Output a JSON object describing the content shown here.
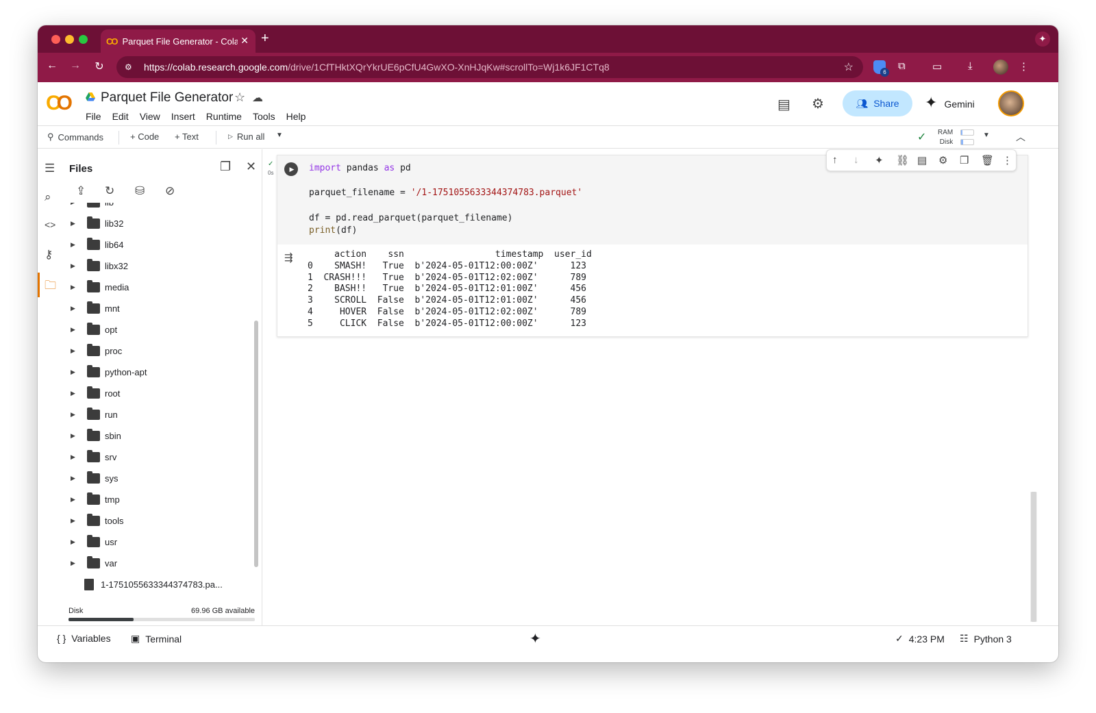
{
  "browser": {
    "tab_title": "Parquet File Generator - Colab",
    "tab_close": "✕",
    "new_tab": "+",
    "url_host": "https://colab.research.google.com",
    "url_path": "/drive/1CfTHktXQrYkrUE6pCfU4GwXO-XnHJqKw#scrollTo=Wj1k6JF1CTq8",
    "extension_badge": "6"
  },
  "header": {
    "notebook_title": "Parquet File Generator",
    "menu": [
      "File",
      "Edit",
      "View",
      "Insert",
      "Runtime",
      "Tools",
      "Help"
    ],
    "share_label": "Share",
    "gemini_label": "Gemini"
  },
  "toolbar": {
    "commands_label": "Commands",
    "code_label": "+ Code",
    "text_label": "+ Text",
    "run_all_label": "Run all",
    "ram_label": "RAM",
    "disk_label": "Disk"
  },
  "files": {
    "title": "Files",
    "items": [
      {
        "name": "lib",
        "type": "folder"
      },
      {
        "name": "lib32",
        "type": "folder"
      },
      {
        "name": "lib64",
        "type": "folder"
      },
      {
        "name": "libx32",
        "type": "folder"
      },
      {
        "name": "media",
        "type": "folder"
      },
      {
        "name": "mnt",
        "type": "folder"
      },
      {
        "name": "opt",
        "type": "folder"
      },
      {
        "name": "proc",
        "type": "folder"
      },
      {
        "name": "python-apt",
        "type": "folder"
      },
      {
        "name": "root",
        "type": "folder"
      },
      {
        "name": "run",
        "type": "folder"
      },
      {
        "name": "sbin",
        "type": "folder"
      },
      {
        "name": "srv",
        "type": "folder"
      },
      {
        "name": "sys",
        "type": "folder"
      },
      {
        "name": "tmp",
        "type": "folder"
      },
      {
        "name": "tools",
        "type": "folder"
      },
      {
        "name": "usr",
        "type": "folder"
      },
      {
        "name": "var",
        "type": "folder"
      },
      {
        "name": "1-1751055633344374783.pa...",
        "type": "file"
      }
    ],
    "disk_label": "Disk",
    "disk_available": "69.96 GB available",
    "disk_used_fraction": 0.35
  },
  "cell": {
    "exec_time": "0s",
    "code_lines": [
      [
        {
          "t": "import",
          "c": "kw"
        },
        {
          "t": " pandas "
        },
        {
          "t": "as",
          "c": "kw"
        },
        {
          "t": " pd"
        }
      ],
      [],
      [
        {
          "t": "parquet_filename = "
        },
        {
          "t": "'/1-1751055633344374783.parquet'",
          "c": "str"
        }
      ],
      [],
      [
        {
          "t": "df = pd.read_parquet(parquet_filename)"
        }
      ],
      [
        {
          "t": "print",
          "c": "fn"
        },
        {
          "t": "(df)"
        }
      ]
    ],
    "output": "     action    ssn                 timestamp  user_id\n0    SMASH!   True  b'2024-05-01T12:00:00Z'      123\n1  CRASH!!!   True  b'2024-05-01T12:02:00Z'      789\n2    BASH!!   True  b'2024-05-01T12:01:00Z'      456\n3    SCROLL  False  b'2024-05-01T12:01:00Z'      456\n4     HOVER  False  b'2024-05-01T12:02:00Z'      789\n5     CLICK  False  b'2024-05-01T12:00:00Z'      123"
  },
  "status": {
    "variables_label": "Variables",
    "terminal_label": "Terminal",
    "time_label": "4:23 PM",
    "runtime_label": "Python 3"
  }
}
